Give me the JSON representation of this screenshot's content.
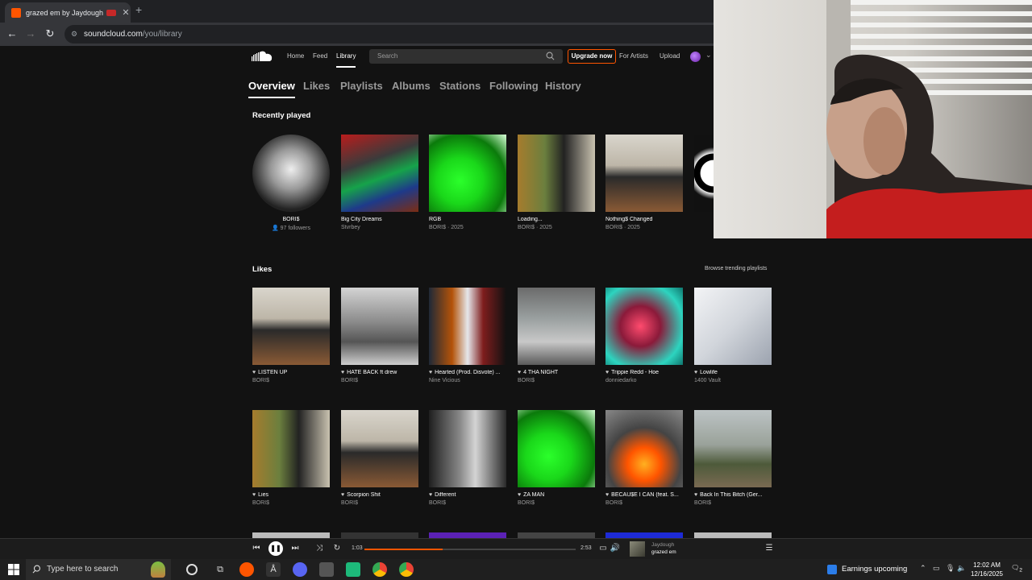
{
  "browser": {
    "tab_title": "grazed em by Jaydough -",
    "url_domain": "soundcloud.com",
    "url_path": "/you/library"
  },
  "header": {
    "nav": [
      "Home",
      "Feed",
      "Library"
    ],
    "search_placeholder": "Search",
    "upgrade": "Upgrade now",
    "for_artists": "For Artists",
    "upload": "Upload"
  },
  "library_tabs": [
    "Overview",
    "Likes",
    "Playlists",
    "Albums",
    "Stations",
    "Following",
    "History"
  ],
  "recently_played": {
    "title": "Recently played",
    "items": [
      {
        "title": "BORI$",
        "sub": "97 followers",
        "art": "bw-circle"
      },
      {
        "title": "Big City Dreams",
        "sub": "Stvrbey",
        "art": "bigcity"
      },
      {
        "title": "RGB",
        "sub": "BORI$ · 2025",
        "art": "green"
      },
      {
        "title": "Loading...",
        "sub": "BORI$ · 2025",
        "art": "car"
      },
      {
        "title": "Nothing$ Changed",
        "sub": "BORI$ · 2025",
        "art": "kitchen"
      }
    ]
  },
  "likes": {
    "title": "Likes",
    "browse": "Browse trending playlists",
    "row1": [
      {
        "title": "LISTEN UP",
        "sub": "BORI$",
        "art": "kitchen"
      },
      {
        "title": "HATE BACK ft drew",
        "sub": "BORI$",
        "art": "coast"
      },
      {
        "title": "Hearted (Prod. Disvote) ...",
        "sub": "Nine Vicious",
        "art": "duo"
      },
      {
        "title": "4 THA NIGHT",
        "sub": "BORI$",
        "art": "mall"
      },
      {
        "title": "Trippie Redd - Hoe",
        "sub": "donniedarko",
        "art": "smoke"
      },
      {
        "title": "Lowlife",
        "sub": "1400 Vault",
        "art": "mickey"
      }
    ],
    "row2": [
      {
        "title": "Lies",
        "sub": "BORI$",
        "art": "car"
      },
      {
        "title": "Scorpion Shit",
        "sub": "BORI$",
        "art": "kitchen"
      },
      {
        "title": "Different",
        "sub": "BORI$",
        "art": "hallway"
      },
      {
        "title": "ZA MAN",
        "sub": "BORI$",
        "art": "green"
      },
      {
        "title": "BECAU$E I CAN (feat. S...",
        "sub": "BORI$",
        "art": "fire"
      },
      {
        "title": "Back In This Bitch (Ger...",
        "sub": "BORI$",
        "art": "park"
      }
    ]
  },
  "player": {
    "current_time": "1:03",
    "total_time": "2:53",
    "progress": 0.37,
    "artist": "Jaydough",
    "track": "grazed em"
  },
  "taskbar": {
    "search_placeholder": "Type here to search",
    "widget": "Earnings upcoming",
    "time": "12:02 AM",
    "date": "12/16/2025",
    "notifications": "2"
  },
  "colors": {
    "accent": "#ff5500",
    "background": "#121212"
  }
}
